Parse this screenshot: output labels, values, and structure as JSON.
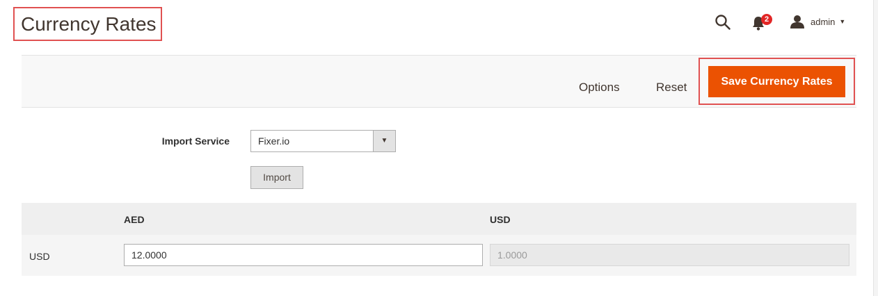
{
  "header": {
    "title": "Currency Rates",
    "notifications_count": "2",
    "user_name": "admin"
  },
  "toolbar": {
    "options_label": "Options",
    "reset_label": "Reset",
    "save_label": "Save Currency Rates"
  },
  "import": {
    "label": "Import Service",
    "selected_service": "Fixer.io",
    "import_button_label": "Import"
  },
  "rates_grid": {
    "columns": [
      "AED",
      "USD"
    ],
    "rows": [
      {
        "label": "USD",
        "values": [
          "12.0000",
          "1.0000"
        ]
      }
    ]
  },
  "colors": {
    "accent": "#eb5202",
    "highlight_border": "#e05151",
    "badge": "#e22626"
  }
}
